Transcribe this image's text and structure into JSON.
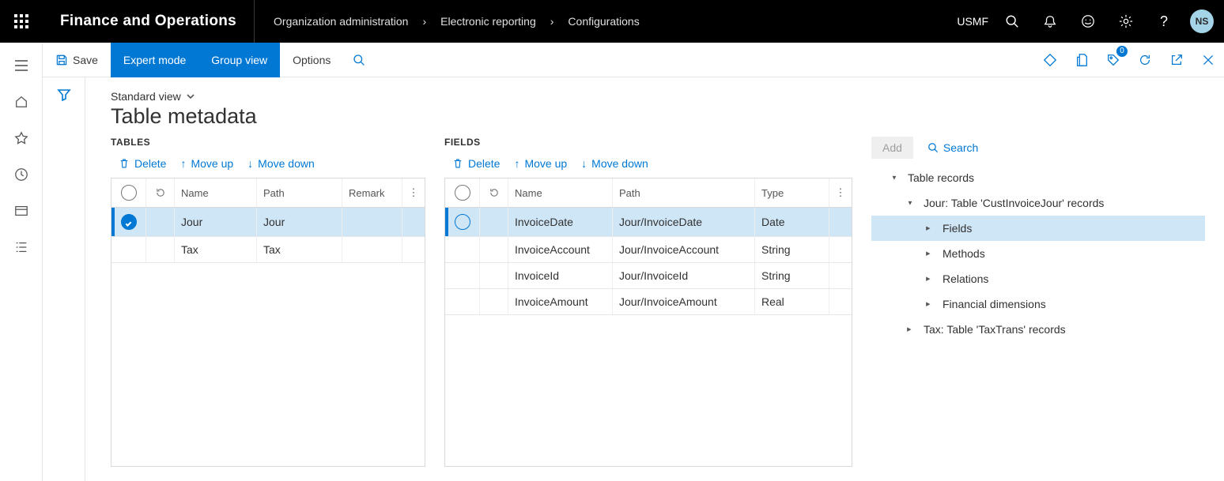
{
  "header": {
    "brand": "Finance and Operations",
    "breadcrumbs": [
      "Organization administration",
      "Electronic reporting",
      "Configurations"
    ],
    "company": "USMF",
    "avatar": "NS"
  },
  "action_bar": {
    "save_label": "Save",
    "expert_mode_label": "Expert mode",
    "group_view_label": "Group view",
    "options_label": "Options",
    "notification_count": "0"
  },
  "view_selector": "Standard view",
  "page_title": "Table metadata",
  "tables_panel": {
    "heading": "TABLES",
    "delete_label": "Delete",
    "move_up_label": "Move up",
    "move_down_label": "Move down",
    "columns": {
      "name": "Name",
      "path": "Path",
      "remark": "Remark"
    },
    "rows": [
      {
        "name": "Jour",
        "path": "Jour",
        "remark": ""
      },
      {
        "name": "Tax",
        "path": "Tax",
        "remark": ""
      }
    ]
  },
  "fields_panel": {
    "heading": "FIELDS",
    "delete_label": "Delete",
    "move_up_label": "Move up",
    "move_down_label": "Move down",
    "columns": {
      "name": "Name",
      "path": "Path",
      "type": "Type"
    },
    "rows": [
      {
        "name": "InvoiceDate",
        "path": "Jour/InvoiceDate",
        "type": "Date"
      },
      {
        "name": "InvoiceAccount",
        "path": "Jour/InvoiceAccount",
        "type": "String"
      },
      {
        "name": "InvoiceId",
        "path": "Jour/InvoiceId",
        "type": "String"
      },
      {
        "name": "InvoiceAmount",
        "path": "Jour/InvoiceAmount",
        "type": "Real"
      }
    ]
  },
  "tree_panel": {
    "add_label": "Add",
    "search_label": "Search",
    "root": "Table records",
    "jour_node": "Jour: Table 'CustInvoiceJour' records",
    "fields_node": "Fields",
    "methods_node": "Methods",
    "relations_node": "Relations",
    "findim_node": "Financial dimensions",
    "tax_node": "Tax: Table 'TaxTrans' records"
  }
}
